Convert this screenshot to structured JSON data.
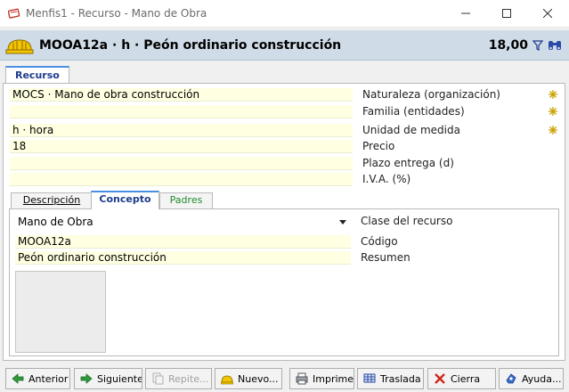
{
  "window": {
    "title": "Menfis1 - Recurso - Mano de Obra"
  },
  "header": {
    "title": "MOOA12a · h · Peón ordinario construcción",
    "price": "18,00"
  },
  "outer_tab": {
    "label": "Recurso"
  },
  "fields": [
    {
      "value": "MOCS · Mano de obra construcción",
      "label": "Naturaleza (organización)"
    },
    {
      "value": "",
      "label": "Familia (entidades)"
    },
    {
      "value": "h · hora",
      "label": "Unidad de medida"
    },
    {
      "value": "18",
      "label": "Precio"
    },
    {
      "value": "",
      "label": "Plazo entrega (d)"
    },
    {
      "value": "",
      "label": "I.V.A. (%)"
    }
  ],
  "inner_tabs": [
    {
      "label": "Descripción"
    },
    {
      "label": "Concepto"
    },
    {
      "label": "Padres"
    }
  ],
  "concepto": {
    "clase": {
      "value": "Mano de Obra",
      "label": "Clase del recurso"
    },
    "codigo": {
      "value": "MOOA12a",
      "label": "Código"
    },
    "resumen": {
      "value": "Peón ordinario construcción",
      "label": "Resumen"
    }
  },
  "buttons": [
    {
      "label": "Anterior",
      "icon": "arrow-left-icon",
      "enabled": true
    },
    {
      "label": "Siguiente",
      "icon": "arrow-right-icon",
      "enabled": true
    },
    {
      "label": "Repite...",
      "icon": "repeat-icon",
      "enabled": false
    },
    {
      "label": "Nuevo...",
      "icon": "new-resource-icon",
      "enabled": true
    },
    {
      "label": "Imprime",
      "icon": "printer-icon",
      "enabled": true
    },
    {
      "label": "Traslada",
      "icon": "transfer-icon",
      "enabled": true
    },
    {
      "label": "Cierra",
      "icon": "close-icon",
      "enabled": true
    },
    {
      "label": "Ayuda...",
      "icon": "help-icon",
      "enabled": true
    }
  ],
  "colors": {
    "field_bg": "#ffffe1",
    "header_bg": "#cfdbe6",
    "tab_accent": "#4a90e2",
    "star": "#c8a000"
  }
}
